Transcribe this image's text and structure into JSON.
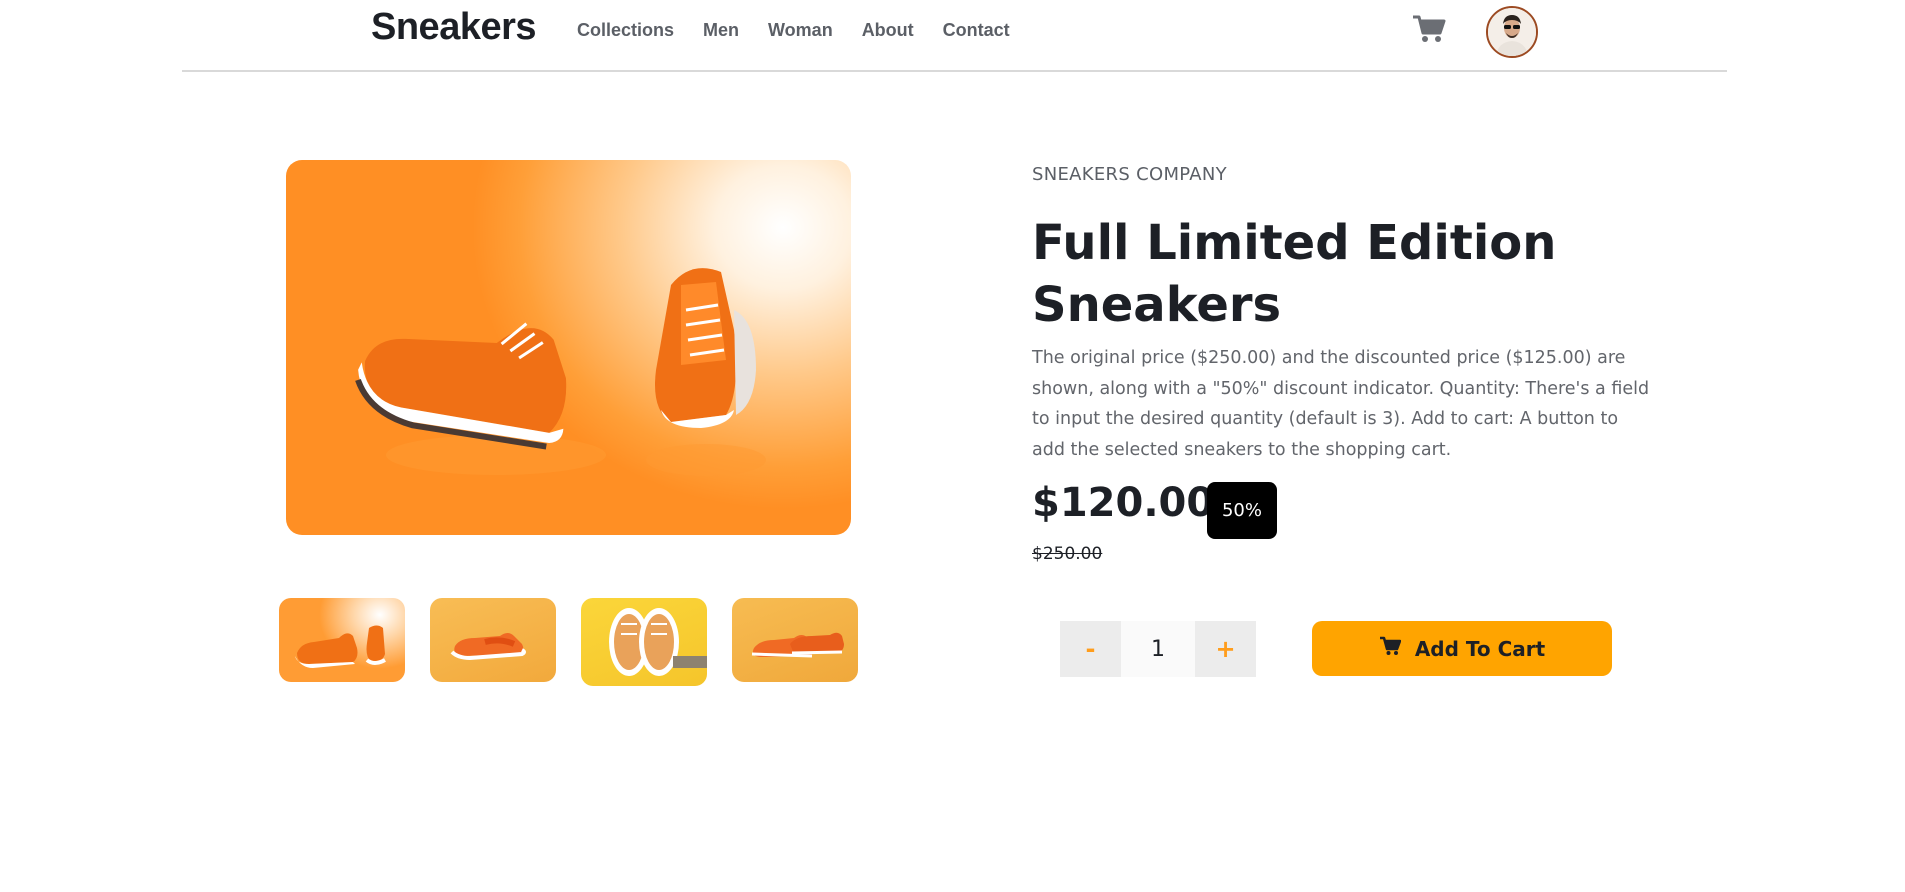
{
  "header": {
    "brand": "Sneakers",
    "nav": [
      "Collections",
      "Men",
      "Woman",
      "About",
      "Contact"
    ],
    "cart_icon": "cart-icon",
    "avatar_icon": "user-avatar"
  },
  "gallery": {
    "main_image": "orange-sneakers-photo",
    "thumbnails": [
      "orange-sneakers-thumb",
      "orange-sneakers-side-thumb",
      "sneakers-top-view-thumb",
      "orange-sneakers-pair-thumb"
    ]
  },
  "product": {
    "company": "SNEAKERS COMPANY",
    "title": "Full Limited Edition Sneakers",
    "description": "The original price ($250.00) and the discounted price ($125.00) are shown, along with a \"50%\" discount indicator. Quantity: There's a field to input the desired quantity (default is 3). Add to cart: A button to add the selected sneakers to the shopping cart.",
    "price": "$120.00",
    "discount": "50%",
    "original_price": "$250.00"
  },
  "cart_controls": {
    "minus_label": "-",
    "quantity": "1",
    "plus_label": "+",
    "add_label": "Add To Cart",
    "add_icon": "cart-icon"
  },
  "colors": {
    "accent": "#ffa400",
    "accent_text": "#ff9d1c",
    "dark": "#1d2026",
    "muted": "#5b5f66",
    "badge": "#000000"
  }
}
